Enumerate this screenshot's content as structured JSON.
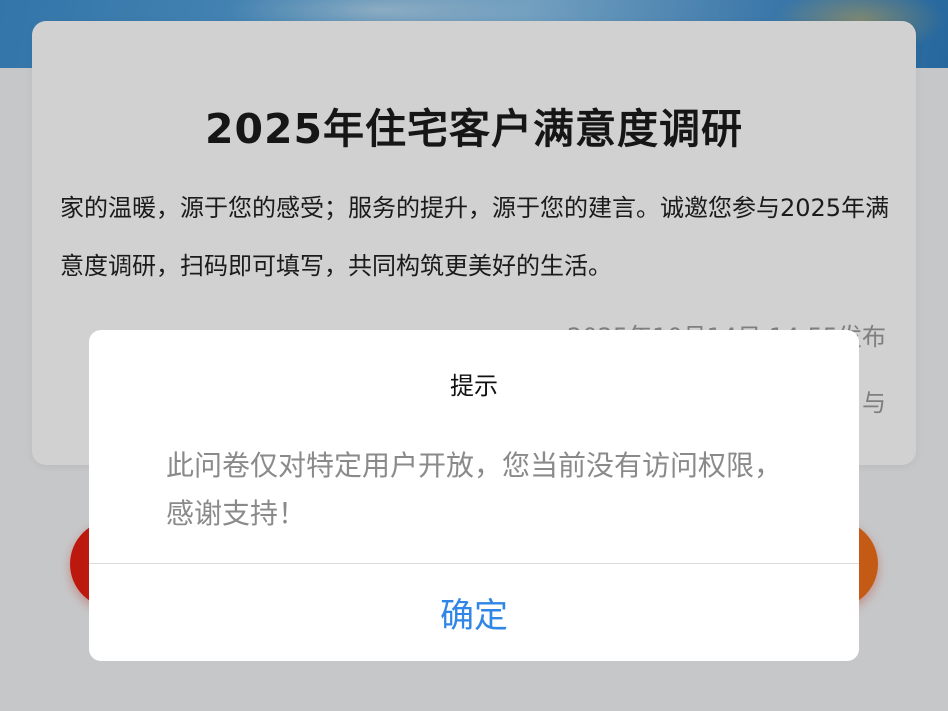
{
  "survey": {
    "title": "2025年住宅客户满意度调研",
    "description": "家的温暖，源于您的感受；服务的提升，源于您的建言。诚邀您参与2025年满意度调研，扫码即可填写，共同构筑更美好的生活。",
    "publish_time": "2025年10月14日 14:55发布",
    "participants_partial": "与"
  },
  "dialog": {
    "title": "提示",
    "message": "此问卷仅对特定用户开放，您当前没有访问权限，感谢支持！",
    "confirm_label": "确定"
  },
  "colors": {
    "accent": "#2f86e6",
    "button_red": "#e61e12",
    "button_orange": "#f0701a"
  }
}
